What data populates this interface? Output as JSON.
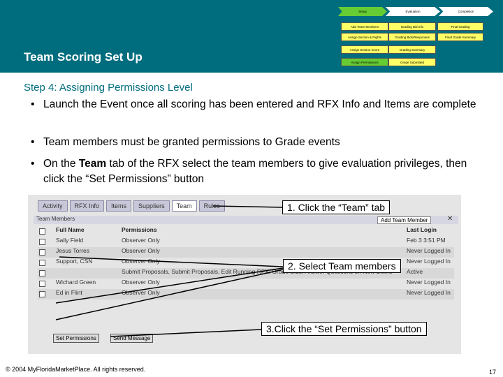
{
  "header": {
    "title": "Team Scoring Set Up",
    "flow": {
      "top": [
        "Setup",
        "Evaluation",
        "Completion"
      ],
      "col1": [
        "Add Team Members",
        "Assign Section & Rights",
        "Assign Section Score",
        "Assign Permissions"
      ],
      "col2": [
        "Grading Bid Info",
        "Grading Bids/Responses",
        "Grading Summary",
        "Grade Submitted"
      ],
      "col3": [
        "Final Grading",
        "Final Grade Summary"
      ]
    }
  },
  "step_heading": "Step 4: Assigning Permissions Level",
  "bullets": [
    {
      "text": "Launch the Event once all scoring has been entered and RFX Info and Items are complete"
    },
    {
      "text": "Team members must be granted permissions to Grade events"
    },
    {
      "pre": "On the ",
      "bold": "Team",
      "post": " tab of the RFX select the team members to give evaluation privileges, then click the “Set Permissions” button"
    }
  ],
  "screenshot": {
    "tabs": [
      "Activity",
      "RFX Info",
      "Items",
      "Suppliers",
      "Team",
      "Rules"
    ],
    "panel_title": "Team Members",
    "panel_tools": "Add Team Member",
    "columns": [
      "Full Name",
      "Permissions",
      "Last Login"
    ],
    "rows": [
      {
        "name": "Sally Field",
        "perm": "Observer Only",
        "login": "Feb 3 3:51 PM"
      },
      {
        "name": "Jesus Torres",
        "perm": "Observer Only",
        "login": "Never Logged In"
      },
      {
        "name": "Support, CSN",
        "perm": "Observer Only",
        "login": "Never Logged In"
      },
      {
        "name": "",
        "perm": "Submit Proposals, Submit Proposals, Edit Running RFX, Grade Bids, Answer Questions on New Doers",
        "login": "Active"
      },
      {
        "name": "Wichard Green",
        "perm": "Observer Only",
        "login": "Never Logged In"
      },
      {
        "name": "Ed in Flint",
        "perm": "Observer Only",
        "login": "Never Logged In"
      }
    ],
    "buttons": [
      "Set Permissions",
      "Send Message"
    ]
  },
  "callouts": [
    "1. Click the “Team” tab",
    "2. Select Team members",
    "3.Click the “Set Permissions” button"
  ],
  "footer": "© 2004 MyFloridaMarketPlace. All rights reserved.",
  "page_number": "17"
}
